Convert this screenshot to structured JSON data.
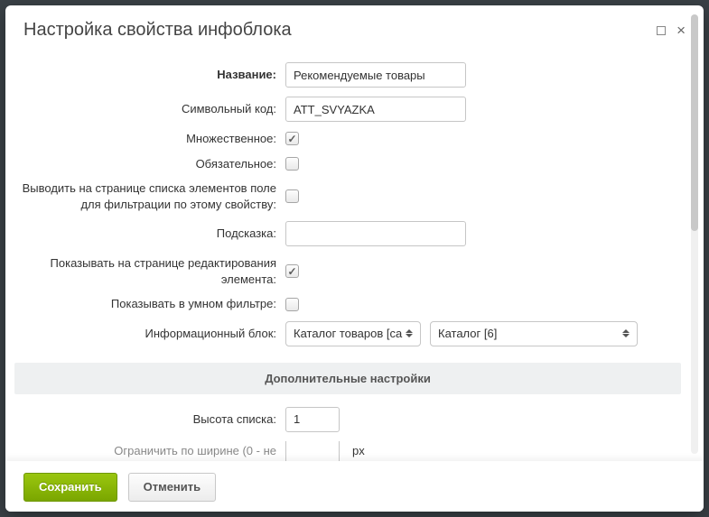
{
  "modal": {
    "title": "Настройка свойства инфоблока"
  },
  "form": {
    "name_label": "Название:",
    "name_value": "Рекомендуемые товары",
    "code_label": "Символьный код:",
    "code_value": "ATT_SVYAZKA",
    "multiple_label": "Множественное:",
    "multiple_checked": true,
    "required_label": "Обязательное:",
    "required_checked": false,
    "filter_label": "Выводить на странице списка элементов поле для фильтрации по этому свойству:",
    "filter_checked": false,
    "hint_label": "Подсказка:",
    "hint_value": "",
    "show_edit_label": "Показывать на странице редактирования элемента:",
    "show_edit_checked": true,
    "smart_filter_label": "Показывать в умном фильтре:",
    "smart_filter_checked": false,
    "iblock_label": "Информационный блок:",
    "iblock_select1": "Каталог товаров [ca",
    "iblock_select2": "Каталог [6]",
    "advanced_header": "Дополнительные настройки",
    "list_height_label": "Высота списка:",
    "list_height_value": "1",
    "width_limit_label": "Ограничить по ширине (0 - не",
    "width_limit_value": "",
    "width_suffix": "px"
  },
  "footer": {
    "save": "Сохранить",
    "cancel": "Отменить"
  }
}
